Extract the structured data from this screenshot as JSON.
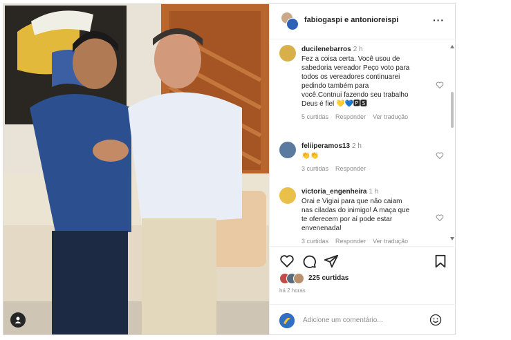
{
  "header": {
    "title": "fabiogaspi e antonioreispi",
    "more_icon": "more-horizontal-icon"
  },
  "comments": [
    {
      "user": "ducilenebarros",
      "time": "2 h",
      "text": "Fez a coisa certa. Você usou de\nsabedoria vereador Peço voto para\ntodos os vereadores continuarei\npedindo também para\nvocê.Contnui fazendo seu trabalho\nDeus é fiel 💛💙🅿🆂",
      "likes": "5 curtidas",
      "reply": "Responder",
      "translate": "Ver tradução",
      "avatar_color": "#d8b04a"
    },
    {
      "user": "feliiperamos13",
      "time": "2 h",
      "text": "👏👏",
      "likes": "3 curtidas",
      "reply": "Responder",
      "avatar_color": "#5b7aa0"
    },
    {
      "user": "victoria_engenheira",
      "time": "1 h",
      "text": "Orai e Vigiai para que não caiam\nnas ciladas do inimigo! A maça que\nte oferecem por aí pode estar\nenvenenada!",
      "likes": "3 curtidas",
      "reply": "Responder",
      "translate": "Ver tradução",
      "avatar_color": "#e8c04a"
    }
  ],
  "actions": {
    "like_icon": "heart-icon",
    "comment_icon": "comment-icon",
    "share_icon": "send-icon",
    "save_icon": "bookmark-icon",
    "likes_count": "225 curtidas",
    "posted": "há 2 horas"
  },
  "add_comment": {
    "placeholder": "Adicione um comentário...",
    "emoji_icon": "emoji-icon"
  }
}
